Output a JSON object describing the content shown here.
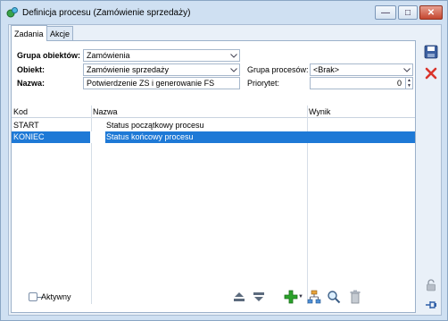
{
  "window": {
    "title": "Definicja procesu (Zamówienie sprzedaży)",
    "controls": {
      "minimize": "—",
      "maximize": "□",
      "close": "✕"
    }
  },
  "tabs": [
    {
      "label": "Zadania",
      "active": true
    },
    {
      "label": "Akcje",
      "active": false
    }
  ],
  "form": {
    "group_label": "Grupa obiektów:",
    "group_value": "Zamówienia",
    "object_label": "Obiekt:",
    "object_value": "Zamówienie sprzedaży",
    "name_label": "Nazwa:",
    "name_value": "Potwierdzenie ZS i generowanie FS",
    "process_group_label": "Grupa procesów:",
    "process_group_value": "<Brak>",
    "priority_label": "Priorytet:",
    "priority_value": "0"
  },
  "grid": {
    "columns": [
      "Kod",
      "Nazwa",
      "Wynik"
    ],
    "rows": [
      {
        "kod": "START",
        "nazwa": "Status początkowy procesu",
        "wynik": "",
        "selected": false
      },
      {
        "kod": "KONIEC",
        "nazwa": "Status końcowy procesu",
        "wynik": "",
        "selected": true
      }
    ]
  },
  "footer": {
    "active_label": "Aktywny",
    "active_checked": false
  },
  "icons": {
    "app": "process-icon",
    "move_up": "move-up-icon",
    "move_down": "move-down-icon",
    "add": "add-icon",
    "hierarchy": "hierarchy-icon",
    "search": "search-icon",
    "delete": "trash-icon",
    "save": "save-icon",
    "close": "close-icon",
    "lock": "lock-icon",
    "pin": "pin-icon"
  },
  "colors": {
    "selection": "#1e79d6",
    "window_bg": "#cfe0f2",
    "add_green": "#2aa22a",
    "close_red": "#d9342b"
  }
}
